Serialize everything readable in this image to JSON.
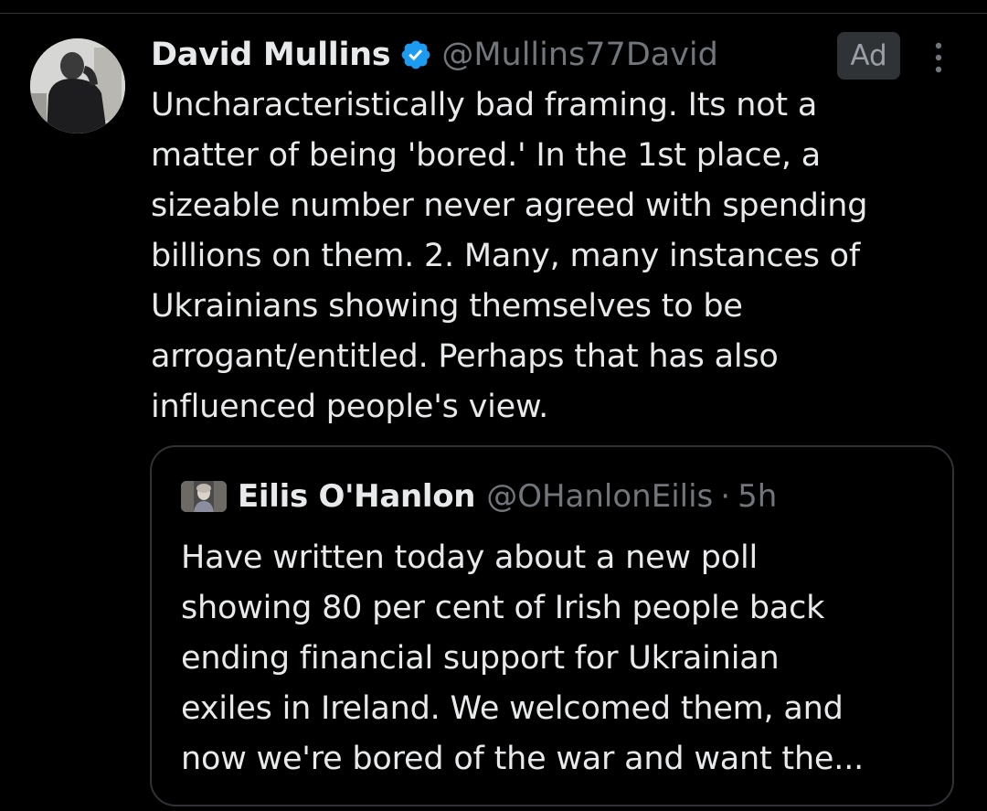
{
  "tweet": {
    "author_name": "David Mullins",
    "author_handle": "@Mullins77David",
    "verified": true,
    "avatar_icon": "user-avatar-photo",
    "ad_label": "Ad",
    "more_icon": "more-vertical-icon",
    "text": "Uncharacteristically bad framing. Its not a\nmatter of being 'bored.' In the 1st place, a\nsizeable number never agreed with spending\nbillions on them. 2. Many, many instances of\nUkrainians showing themselves to be\narrogant/entitled. Perhaps that has also\ninfluenced people's view."
  },
  "quote": {
    "author_name": "Eilis O'Hanlon",
    "author_handle": "@OHanlonEilis",
    "separator": "·",
    "time": "5h",
    "avatar_icon": "user-avatar-photo",
    "text": "Have written today about  a new poll\nshowing 80 per cent of Irish people back\nending financial support for Ukrainian\nexiles in Ireland.  We welcomed them, and\nnow we're bored of the war and want the..."
  },
  "colors": {
    "background": "#000000",
    "text_primary": "#e7e9ea",
    "text_secondary": "#71767b",
    "border": "#2f3336",
    "verified_blue": "#1d9bf0"
  }
}
